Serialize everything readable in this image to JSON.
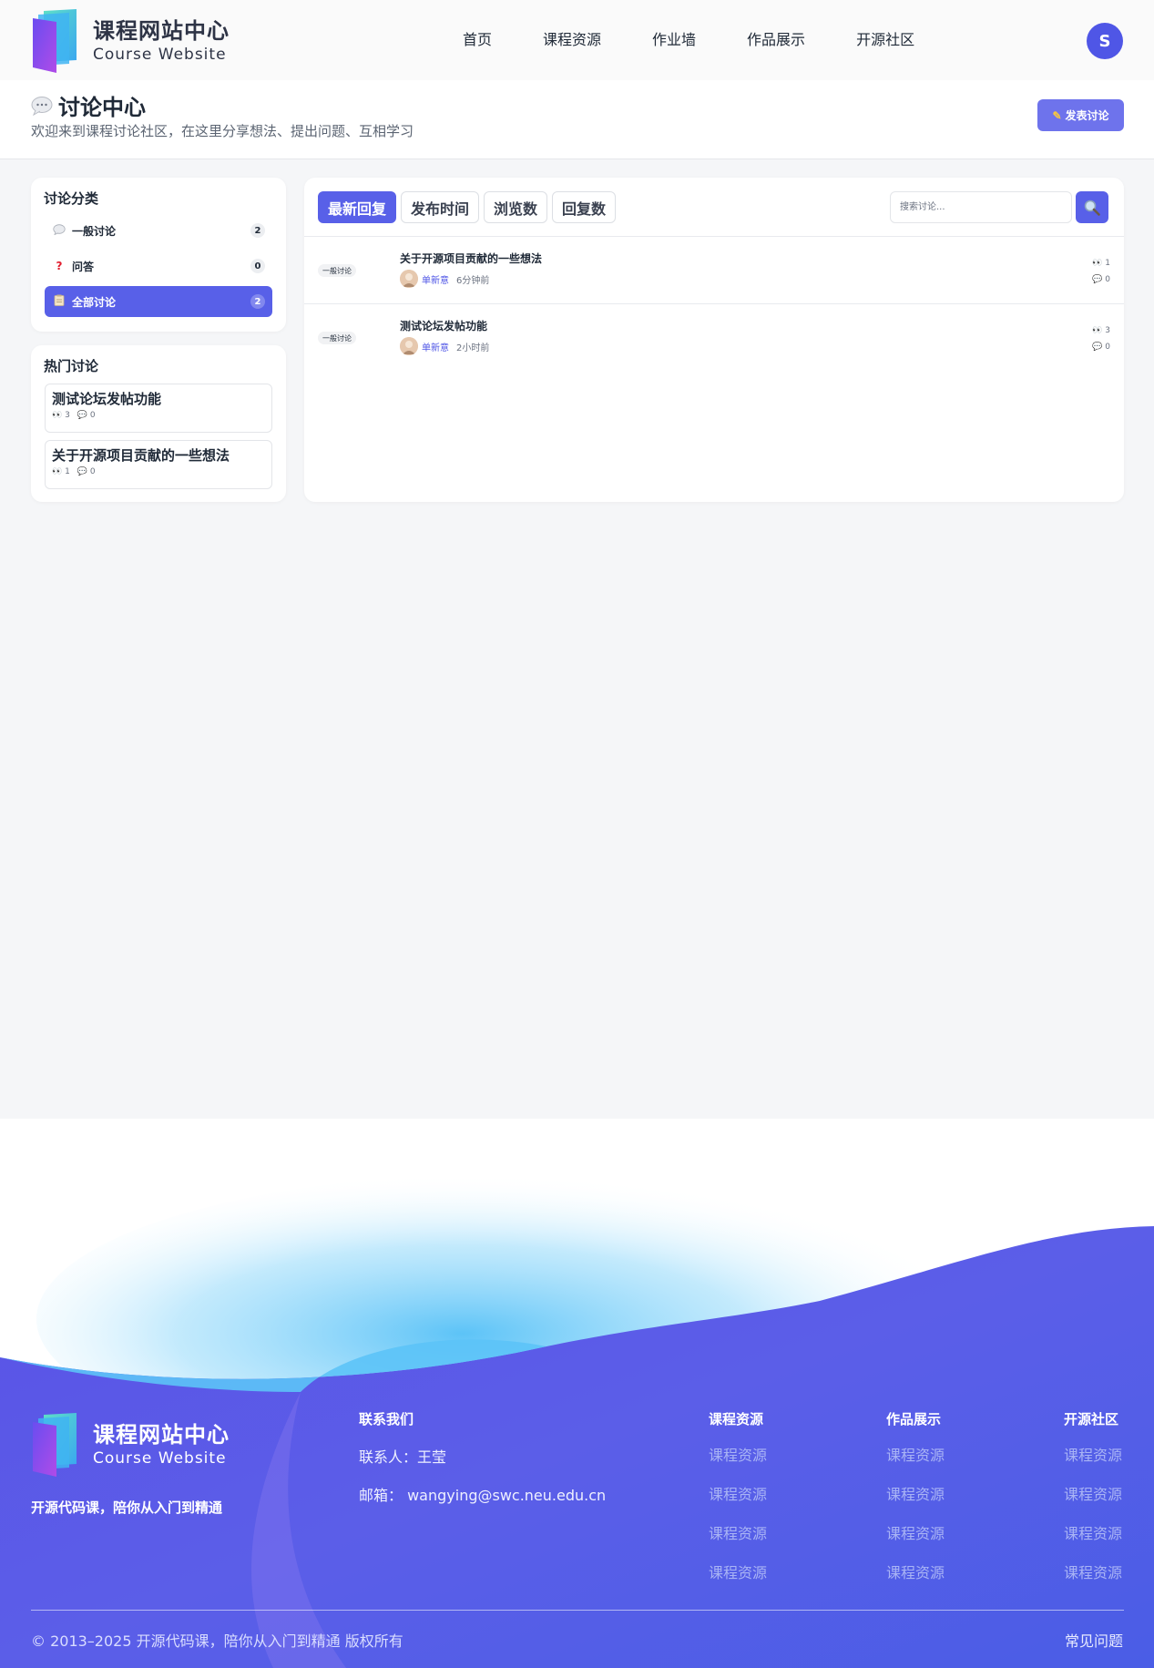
{
  "header": {
    "brand_cn": "课程网站中心",
    "brand_en": "Course Website",
    "nav": [
      "首页",
      "课程资源",
      "作业墙",
      "作品展示",
      "开源社区"
    ],
    "user_initial": "S"
  },
  "page": {
    "title": "讨论中心",
    "subtitle": "欢迎来到课程讨论社区，在这里分享想法、提出问题、互相学习",
    "post_button": "发表讨论"
  },
  "sidebar": {
    "categories_title": "讨论分类",
    "categories": [
      {
        "icon": "speech-bubble-icon",
        "label": "一般讨论",
        "count": "2"
      },
      {
        "icon": "question-mark-icon",
        "label": "问答",
        "count": "0"
      },
      {
        "icon": "clipboard-icon",
        "label": "全部讨论",
        "count": "2",
        "active": true
      }
    ],
    "hot_title": "热门讨论",
    "hot": [
      {
        "title": "测试论坛发帖功能",
        "views": "3",
        "replies": "0"
      },
      {
        "title": "关于开源项目贡献的一些想法",
        "views": "1",
        "replies": "0"
      }
    ]
  },
  "main": {
    "tabs": [
      "最新回复",
      "发布时间",
      "浏览数",
      "回复数"
    ],
    "active_tab": 0,
    "search_placeholder": "搜索讨论...",
    "threads": [
      {
        "tag": "一般讨论",
        "title": "关于开源项目贡献的一些想法",
        "author": "单新意",
        "time": "6分钟前",
        "views": "1",
        "replies": "0"
      },
      {
        "tag": "一般讨论",
        "title": "测试论坛发帖功能",
        "author": "单新意",
        "time": "2小时前",
        "views": "3",
        "replies": "0"
      }
    ]
  },
  "footer": {
    "brand_cn": "课程网站中心",
    "brand_en": "Course Website",
    "slogan": "开源代码课，陪你从入门到精通",
    "contact_title": "联系我们",
    "contact_person": "联系人：王莹",
    "contact_email": "邮箱：  wangying@swc.neu.edu.cn",
    "columns": [
      {
        "title": "课程资源",
        "links": [
          "课程资源",
          "课程资源",
          "课程资源",
          "课程资源"
        ]
      },
      {
        "title": "作品展示",
        "links": [
          "课程资源",
          "课程资源",
          "课程资源",
          "课程资源"
        ]
      },
      {
        "title": "开源社区",
        "links": [
          "课程资源",
          "课程资源",
          "课程资源",
          "课程资源"
        ]
      }
    ],
    "copyright": "© 2013–2025 开源代码课，陪你从入门到精通 版权所有",
    "faq": "常见问题"
  },
  "colors": {
    "accent": "#5860e8",
    "footer_blue": "#4b5de8",
    "footer_light": "#5cc3f7"
  }
}
